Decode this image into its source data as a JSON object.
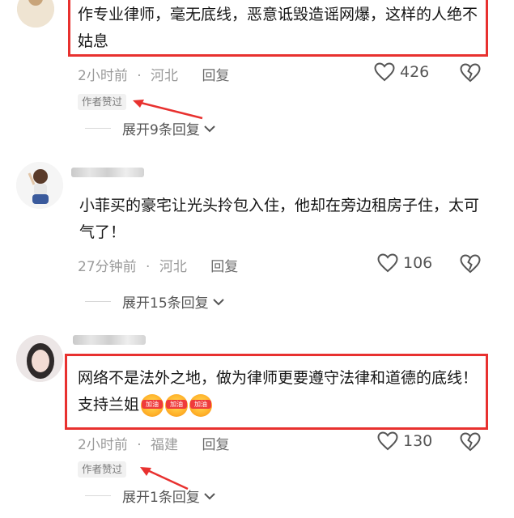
{
  "comments": [
    {
      "text": "作专业律师，毫无底线，恶意诋毁造谣网爆，这样的人绝不姑息",
      "time": "2小时前",
      "location": "河北",
      "reply_label": "回复",
      "likes": "426",
      "author_badge": "作者赞过",
      "expand_label": "展开9条回复"
    },
    {
      "text": "小菲买的豪宅让光头拎包入住，他却在旁边租房子住，太可气了！",
      "time": "27分钟前",
      "location": "河北",
      "reply_label": "回复",
      "likes": "106",
      "expand_label": "展开15条回复"
    },
    {
      "text": "网络不是法外之地，做为律师更要遵守法律和道德的底线！支持兰姐",
      "emoji_label": "加油",
      "time": "2小时前",
      "location": "福建",
      "reply_label": "回复",
      "likes": "130",
      "author_badge": "作者赞过",
      "expand_label": "展开1条回复"
    }
  ],
  "separator": "·",
  "colors": {
    "highlight_border": "#e8312f",
    "annotation_arrow": "#e8312f",
    "meta_text": "#9a9a9a"
  }
}
